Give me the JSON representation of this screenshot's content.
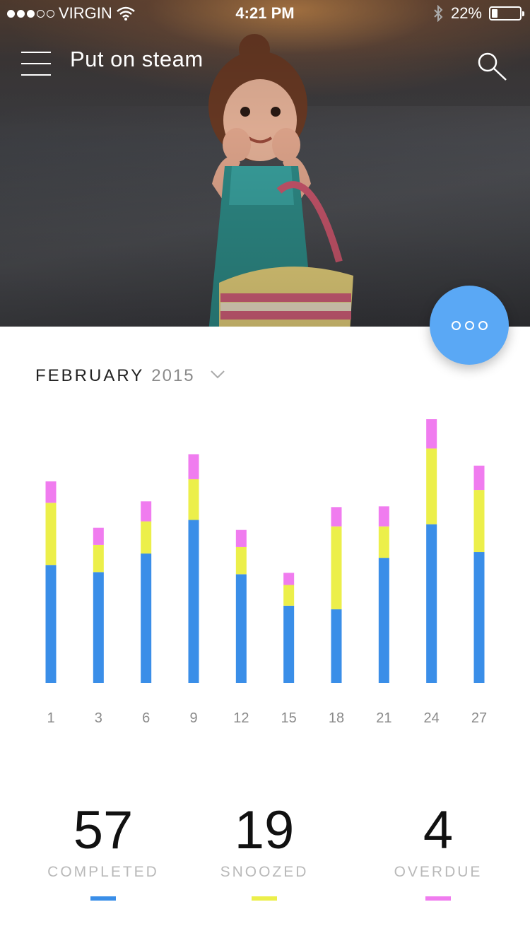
{
  "status_bar": {
    "carrier": "VIRGIN",
    "time": "4:21 PM",
    "battery": "22%",
    "battery_level": 0.22,
    "signal_bars": 3,
    "icons": [
      "signal-dots-icon",
      "wifi-icon",
      "bluetooth-icon",
      "battery-icon"
    ]
  },
  "nav": {
    "title": "Put on steam",
    "menu_icon": "menu-icon",
    "search_icon": "search-icon"
  },
  "fab": {
    "icon": "more-options-icon",
    "color": "#5aa8f5"
  },
  "month_selector": {
    "month": "FEBRUARY",
    "year": "2015",
    "icon": "chevron-down-icon"
  },
  "colors": {
    "completed": "#3a8ee8",
    "snoozed": "#ecef4a",
    "overdue": "#f07cef"
  },
  "chart_data": {
    "type": "bar",
    "stacked": true,
    "categories": [
      "1",
      "3",
      "6",
      "9",
      "12",
      "15",
      "18",
      "21",
      "24",
      "27"
    ],
    "series": [
      {
        "name": "COMPLETED",
        "values": [
          165,
          155,
          181,
          228,
          152,
          108,
          103,
          175,
          222,
          183
        ]
      },
      {
        "name": "SNOOZED",
        "values": [
          87,
          38,
          45,
          57,
          38,
          29,
          116,
          44,
          106,
          87
        ]
      },
      {
        "name": "OVERDUE",
        "values": [
          30,
          24,
          28,
          35,
          24,
          17,
          27,
          28,
          41,
          34
        ]
      }
    ],
    "ylim": [
      0,
      370
    ],
    "grid": false,
    "legend": "none"
  },
  "stats": [
    {
      "value": "57",
      "label": "COMPLETED",
      "color": "#3a8ee8"
    },
    {
      "value": "19",
      "label": "SNOOZED",
      "color": "#ecef4a"
    },
    {
      "value": "4",
      "label": "OVERDUE",
      "color": "#f07cef"
    }
  ]
}
